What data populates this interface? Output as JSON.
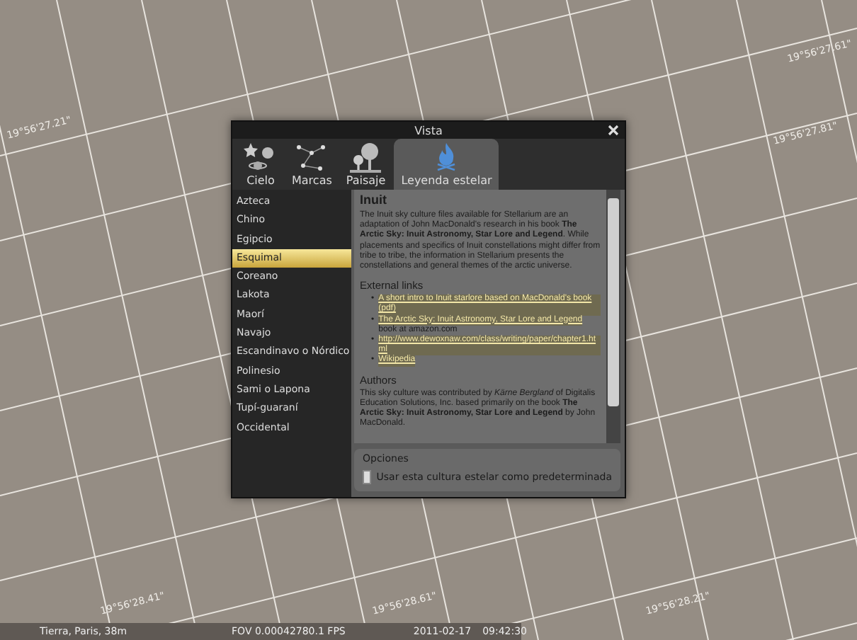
{
  "sky_labels": [
    {
      "text": "19°56'27.21\""
    },
    {
      "text": "19°56'27.81\""
    },
    {
      "text": "19°56'27.61\""
    },
    {
      "text": "19°56'28.41\""
    },
    {
      "text": "19°56'28.61\""
    },
    {
      "text": "19°56'28.21\""
    }
  ],
  "window": {
    "title": "Vista"
  },
  "tabs": [
    {
      "label": "Cielo",
      "kind": "sky",
      "selected": false
    },
    {
      "label": "Marcas",
      "kind": "markings",
      "selected": false
    },
    {
      "label": "Paisaje",
      "kind": "landscape",
      "selected": false
    },
    {
      "label": "Leyenda estelar",
      "kind": "starlore",
      "selected": true
    }
  ],
  "cultures": [
    {
      "label": "Azteca",
      "selected": false
    },
    {
      "label": "Chino",
      "selected": false
    },
    {
      "label": "Egipcio",
      "selected": false
    },
    {
      "label": "Esquimal",
      "selected": true
    },
    {
      "label": "Coreano",
      "selected": false
    },
    {
      "label": "Lakota",
      "selected": false
    },
    {
      "label": "Maorí",
      "selected": false
    },
    {
      "label": "Navajo",
      "selected": false
    },
    {
      "label": "Escandinavo o Nórdico",
      "selected": false
    },
    {
      "label": "Polinesio",
      "selected": false
    },
    {
      "label": "Sami o Lapona",
      "selected": false
    },
    {
      "label": "Tupí-guaraní",
      "selected": false
    },
    {
      "label": "Occidental",
      "selected": false
    }
  ],
  "description": {
    "heading": "Inuit",
    "intro": "The Inuit sky culture files available for Stellarium are an adaptation of John MacDonald's research in his book **The Arctic Sky: Inuit Astronomy, Star Lore and Legend**. While placements and specifics of Inuit constellations might differ from tribe to tribe, the information in Stellarium presents the constellations and general themes of the arctic universe.",
    "links_heading": "External links",
    "links": [
      {
        "bullet": "•",
        "text": "A short intro to Inuit starlore based on MacDonald's book (pdf)"
      },
      {
        "bullet": "•",
        "text": "The Arctic Sky: Inuit Astronomy, Star Lore and Legend",
        "suffix": " book at amazon.com"
      },
      {
        "bullet": "•",
        "text": "http://www.dewoxnaw.com/class/writing/paper/chapter1.html"
      },
      {
        "bullet": "•",
        "text": "Wikipedia"
      }
    ],
    "authors_heading": "Authors",
    "authors": "This sky culture was contributed by *Kärne Bergland* of Digitalis Education Solutions, Inc. based primarily on the book **The Arctic Sky: Inuit Astronomy, Star Lore and Legend** by John MacDonald."
  },
  "options": {
    "heading": "Opciones",
    "checkbox": {
      "label": "Usar esta cultura estelar como predeterminada",
      "checked": false
    }
  },
  "status_bar": {
    "location": "Tierra, Paris, 38m",
    "fov": "FOV 0.00042780.1 FPS",
    "date": "2011-02-17",
    "time": "09:42:30"
  }
}
